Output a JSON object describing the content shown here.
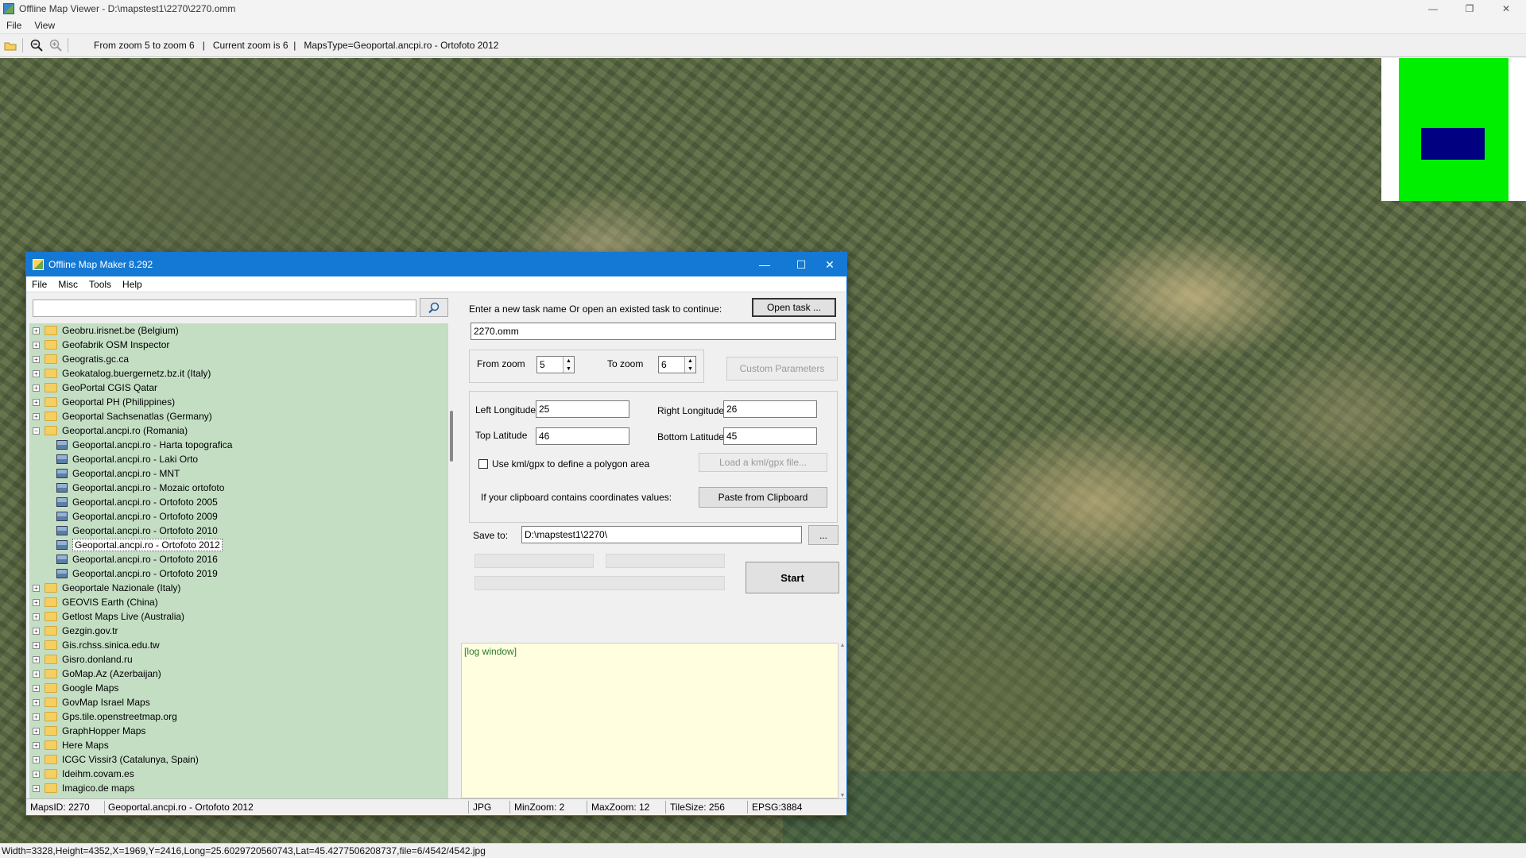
{
  "main": {
    "title": "Offline Map Viewer - D:\\mapstest1\\2270\\2270.omm",
    "menu": [
      "File",
      "View"
    ],
    "toolbar": {
      "info": "From zoom 5 to zoom 6   |   Current zoom is 6  |   MapsType=Geoportal.ancpi.ro - Ortofoto 2012"
    },
    "window_controls": {
      "minimize": "—",
      "restore": "❐",
      "close": "✕"
    },
    "status": "Width=3328,Height=4352,X=1969,Y=2416,Long=25.6029720560743,Lat=45.4277506208737,file=6/4542/4542.jpg"
  },
  "dialog": {
    "title": "Offline Map Maker 8.292",
    "menu": [
      "File",
      "Misc",
      "Tools",
      "Help"
    ],
    "controls": {
      "minimize": "—",
      "maximize": "☐",
      "close": "✕"
    },
    "search": {
      "value": "",
      "icon": "search-icon"
    },
    "tree": [
      {
        "label": "Geobru.irisnet.be (Belgium)",
        "type": "folder"
      },
      {
        "label": "Geofabrik OSM Inspector",
        "type": "folder"
      },
      {
        "label": "Geogratis.gc.ca",
        "type": "folder"
      },
      {
        "label": "Geokatalog.buergernetz.bz.it (Italy)",
        "type": "folder"
      },
      {
        "label": "GeoPortal CGIS Qatar",
        "type": "folder"
      },
      {
        "label": "Geoportal PH (Philippines)",
        "type": "folder"
      },
      {
        "label": "Geoportal Sachsenatlas (Germany)",
        "type": "folder"
      },
      {
        "label": "Geoportal.ancpi.ro (Romania)",
        "type": "folder-open"
      },
      {
        "label": "Geoportal.ancpi.ro - Harta topografica",
        "type": "map"
      },
      {
        "label": "Geoportal.ancpi.ro - Laki Orto",
        "type": "map"
      },
      {
        "label": "Geoportal.ancpi.ro - MNT",
        "type": "map"
      },
      {
        "label": "Geoportal.ancpi.ro - Mozaic ortofoto",
        "type": "map"
      },
      {
        "label": "Geoportal.ancpi.ro - Ortofoto 2005",
        "type": "map"
      },
      {
        "label": "Geoportal.ancpi.ro - Ortofoto 2009",
        "type": "map"
      },
      {
        "label": "Geoportal.ancpi.ro - Ortofoto 2010",
        "type": "map"
      },
      {
        "label": "Geoportal.ancpi.ro - Ortofoto 2012",
        "type": "map",
        "selected": true
      },
      {
        "label": "Geoportal.ancpi.ro - Ortofoto 2016",
        "type": "map"
      },
      {
        "label": "Geoportal.ancpi.ro - Ortofoto 2019",
        "type": "map"
      },
      {
        "label": "Geoportale Nazionale (Italy)",
        "type": "folder"
      },
      {
        "label": "GEOVIS Earth (China)",
        "type": "folder"
      },
      {
        "label": "Getlost Maps Live (Australia)",
        "type": "folder"
      },
      {
        "label": "Gezgin.gov.tr",
        "type": "folder"
      },
      {
        "label": "Gis.rchss.sinica.edu.tw",
        "type": "folder"
      },
      {
        "label": "Gisro.donland.ru",
        "type": "folder"
      },
      {
        "label": "GoMap.Az (Azerbaijan)",
        "type": "folder"
      },
      {
        "label": "Google Maps",
        "type": "folder"
      },
      {
        "label": "GovMap Israel Maps",
        "type": "folder"
      },
      {
        "label": "Gps.tile.openstreetmap.org",
        "type": "folder"
      },
      {
        "label": "GraphHopper Maps",
        "type": "folder"
      },
      {
        "label": "Here Maps",
        "type": "folder"
      },
      {
        "label": "ICGC Vissir3 (Catalunya, Spain)",
        "type": "folder"
      },
      {
        "label": "Ideihm.covam.es",
        "type": "folder"
      },
      {
        "label": "Imagico.de maps",
        "type": "folder"
      }
    ],
    "task": {
      "prompt": "Enter a new task name Or open an existed task to continue:",
      "open_button": "Open task ...",
      "name": "2270.omm"
    },
    "zoom": {
      "from_label": "From zoom",
      "from_value": "5",
      "to_label": "To zoom",
      "to_value": "6",
      "custom_button": "Custom Parameters"
    },
    "coords": {
      "left_lon_label": "Left Longitude",
      "left_lon": "25",
      "right_lon_label": "Right Longitude",
      "right_lon": "26",
      "top_lat_label": "Top Latitude",
      "top_lat": "46",
      "bottom_lat_label": "Bottom Latitude",
      "bottom_lat": "45",
      "kml_label": "Use kml/gpx to define a polygon area",
      "kml_checked": false,
      "kml_button": "Load a kml/gpx file...",
      "clipboard_label": "If your clipboard contains coordinates values:",
      "clipboard_button": "Paste from Clipboard"
    },
    "save": {
      "label": "Save to:",
      "path": "D:\\mapstest1\\2270\\",
      "browse_button": "...",
      "start_button": "Start"
    },
    "log": "[log window]",
    "status": {
      "maps_id": "MapsID: 2270",
      "map_name": "Geoportal.ancpi.ro - Ortofoto 2012",
      "format": "JPG",
      "min_zoom": "MinZoom: 2",
      "max_zoom": "MaxZoom: 12",
      "tile_size": "TileSize: 256",
      "epsg": "EPSG:3884"
    }
  },
  "colors": {
    "dialog_titlebar": "#1479d4",
    "tree_bg": "#c4dec4",
    "log_bg": "#ffffe0",
    "minimap_green": "#00ee00",
    "minimap_view": "#000080"
  }
}
